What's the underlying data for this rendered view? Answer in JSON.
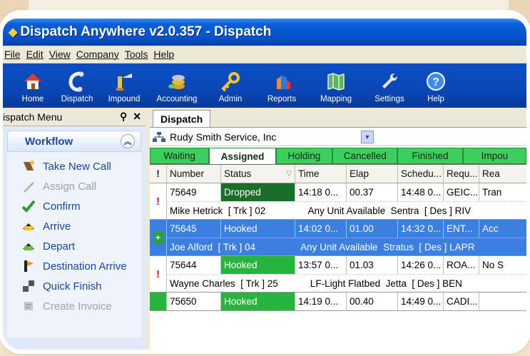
{
  "window": {
    "title": "Dispatch Anywhere v2.0.357 - Dispatch"
  },
  "menu": [
    "File",
    "Edit",
    "View",
    "Company",
    "Tools",
    "Help"
  ],
  "toolbar": [
    {
      "label": "Home",
      "icon": "home-icon"
    },
    {
      "label": "Dispatch",
      "icon": "phone-icon"
    },
    {
      "label": "Impound",
      "icon": "impound-icon"
    },
    {
      "label": "Accounting",
      "icon": "coins-icon"
    },
    {
      "label": "Admin",
      "icon": "key-icon"
    },
    {
      "label": "Reports",
      "icon": "reports-icon"
    },
    {
      "label": "Mapping",
      "icon": "map-icon"
    },
    {
      "label": "Settings",
      "icon": "wrench-icon"
    },
    {
      "label": "Help",
      "icon": "help-icon"
    }
  ],
  "left_pane": {
    "title": "ispatch Menu",
    "workflow_title": "Workflow",
    "items": [
      {
        "label": "Take New Call",
        "enabled": true
      },
      {
        "label": "Assign Call",
        "enabled": false
      },
      {
        "label": "Confirm",
        "enabled": true
      },
      {
        "label": "Arrive",
        "enabled": true
      },
      {
        "label": "Depart",
        "enabled": true
      },
      {
        "label": "Destination Arrive",
        "enabled": true
      },
      {
        "label": "Quick Finish",
        "enabled": true
      },
      {
        "label": "Create Invoice",
        "enabled": false
      }
    ]
  },
  "document_tab": "Dispatch",
  "company": "Rudy Smith Service, Inc",
  "status_tabs": [
    "Waiting",
    "Assigned",
    "Holding",
    "Cancelled",
    "Finished",
    "Impou"
  ],
  "active_status_tab": "Assigned",
  "columns": [
    "!",
    "Number",
    "Status",
    "Time",
    "Elap",
    "Schedu...",
    "Requ...",
    "Rea"
  ],
  "rows": [
    {
      "flag": "!",
      "number": "75649",
      "status": "Dropped",
      "time": "14:18 0...",
      "elap": "00.37",
      "sched": "14:48 0...",
      "req": "GEIC...",
      "rea": "Tran",
      "detail": "Mike Hetrick  [ Trk ] 02                Any Unit Available  Sentra  [ Des ] RIV",
      "status_color": "#1a6e2a",
      "selected": false
    },
    {
      "flag": "+",
      "number": "75645",
      "status": "Hooked",
      "time": "14:02 0...",
      "elap": "01.00",
      "sched": "14:32 0...",
      "req": "ENT...",
      "rea": "Acc",
      "detail": "Joe Alford  [ Trk ] 04                 Any Unit Available  Stratus  [ Des ] LAPR",
      "status_color": "#3d7fe0",
      "selected": true
    },
    {
      "flag": "!",
      "number": "75644",
      "status": "Hooked",
      "time": "13:57 0...",
      "elap": "01.03",
      "sched": "14:26 0...",
      "req": "ROA...",
      "rea": "No S",
      "detail": "Wayne Charles  [ Trk ] 25            LF-Light Flatbed  Jetta  [ Des ] BEN",
      "status_color": "#26b43e",
      "selected": false
    },
    {
      "flag": "",
      "number": "75650",
      "status": "Hooked",
      "time": "14:19 0...",
      "elap": "00.40",
      "sched": "14:49 0...",
      "req": "CADI...",
      "rea": "",
      "detail": "",
      "status_color": "#26b43e",
      "selected": false
    }
  ]
}
